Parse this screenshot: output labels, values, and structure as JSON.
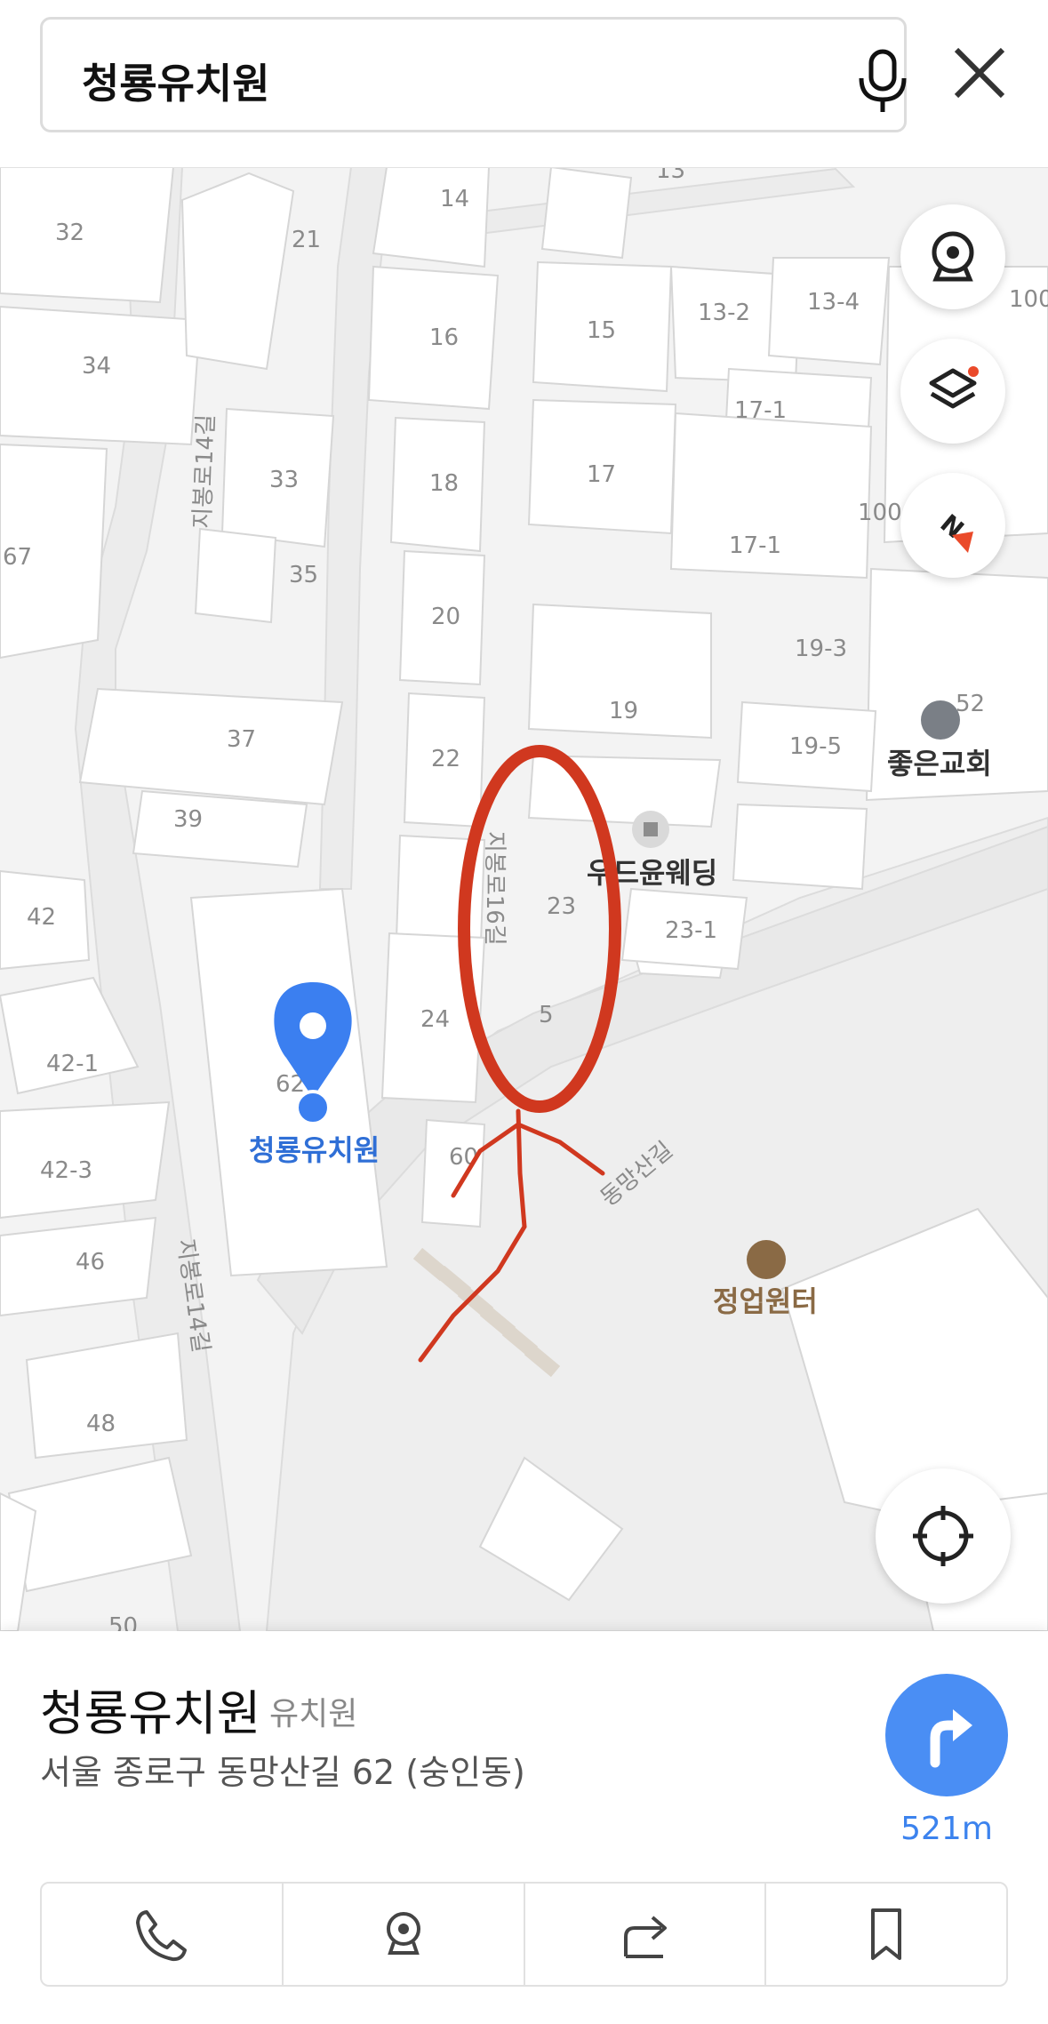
{
  "search": {
    "query": "청룡유치원"
  },
  "map": {
    "building_numbers": [
      "32",
      "21",
      "14",
      "13",
      "34",
      "16",
      "15",
      "13-2",
      "13-4",
      "100",
      "17-1",
      "33",
      "18",
      "17",
      "67",
      "35",
      "100",
      "17-1",
      "20",
      "19-3",
      "37",
      "19",
      "52",
      "22",
      "19-5",
      "39",
      "23",
      "23-1",
      "42",
      "24",
      "5",
      "42-1",
      "62",
      "60",
      "42-3",
      "46",
      "48",
      "50"
    ],
    "street_labels": [
      "지봉로14길",
      "지봉로16길",
      "동망산길",
      "지봉로14길"
    ],
    "poi": {
      "church": "좋은교회",
      "wedding": "우드윤웨딩",
      "pavilion": "정업원터",
      "selected": "청룡유치원"
    },
    "colors": {
      "marker": "#3b7ff0",
      "annotation": "#d0381f",
      "pavilion": "#8a6a45"
    }
  },
  "place": {
    "name": "청룡유치원",
    "category": "유치원",
    "address": "서울 종로구 동망산길 62 (숭인동)",
    "distance": "521m"
  },
  "actions": [
    "phone-icon",
    "street-view-icon",
    "share-icon",
    "bookmark-icon"
  ]
}
